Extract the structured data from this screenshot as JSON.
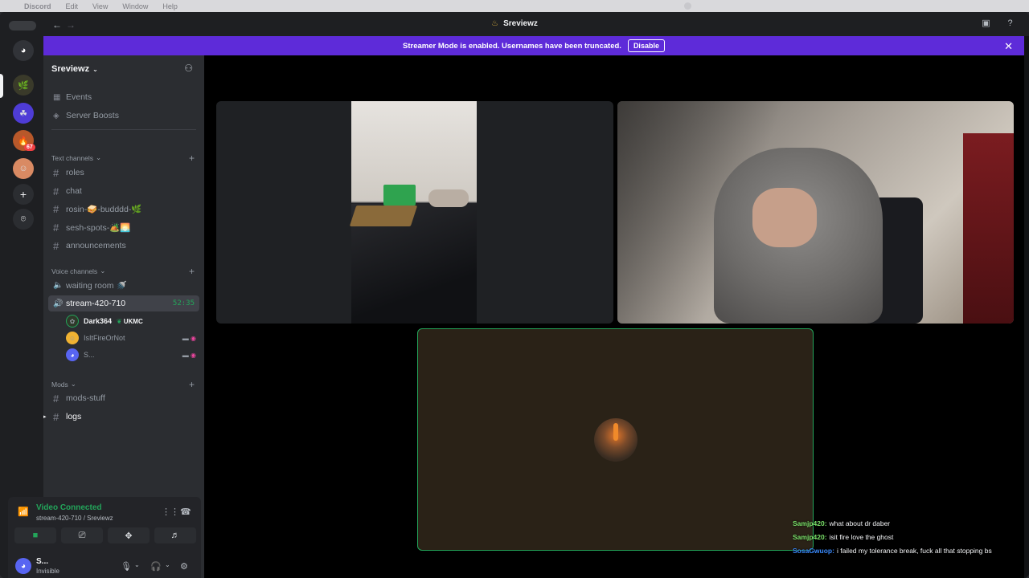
{
  "menubar": {
    "app": "Discord",
    "items": [
      "Edit",
      "View",
      "Window",
      "Help"
    ]
  },
  "titlebar": {
    "title": "Sreviewz"
  },
  "banner": {
    "text": "Streamer Mode is enabled. Usernames have been truncated.",
    "button": "Disable"
  },
  "guilds": {
    "badge_count": "67"
  },
  "server": {
    "name": "Sreviewz"
  },
  "nav": [
    {
      "label": "Events"
    },
    {
      "label": "Server Boosts"
    }
  ],
  "categories": {
    "text": "Text channels",
    "voice": "Voice channels",
    "mods": "Mods"
  },
  "text_channels": [
    "roles",
    "chat",
    "rosin-🥪-budddd-🌿",
    "sesh-spots-🏕️🌅",
    "announcements"
  ],
  "voice_channels": [
    {
      "name": "waiting room 🚿"
    },
    {
      "name": "stream-420-710",
      "timer": "52:35"
    }
  ],
  "voice_users": [
    {
      "name": "Dark364",
      "tag": "UKMC"
    },
    {
      "name": "IsItFireOrNot"
    },
    {
      "name": "S..."
    }
  ],
  "mods_channels": [
    "mods-stuff",
    "logs"
  ],
  "voice_panel": {
    "status": "Video Connected",
    "channel": "stream-420-710 / Sreviewz"
  },
  "user": {
    "name": "S...",
    "status": "Invisible"
  },
  "chat": [
    {
      "name": "Samjp420:",
      "text": "what about dr daber",
      "color": "#7be36a"
    },
    {
      "name": "Samjp420:",
      "text": "isit fire love the ghost",
      "color": "#7be36a"
    },
    {
      "name": "SosaGwuop:",
      "text": "i failed my tolerance break, fuck all that stopping bs",
      "color": "#3a8bff"
    }
  ],
  "colors": {
    "accent": "#5865f2",
    "banner": "#5e2bd9",
    "voice_green": "#23a55a"
  }
}
